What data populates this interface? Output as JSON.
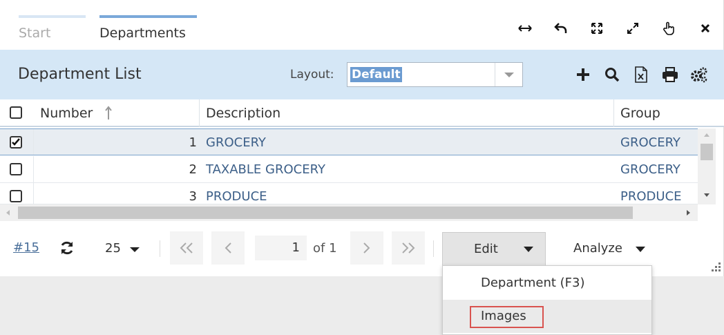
{
  "tabs": [
    {
      "label": "Start"
    },
    {
      "label": "Departments"
    }
  ],
  "window_icons": [
    "resize-horizontal-icon",
    "undo-icon",
    "fullscreen-icon",
    "expand-icon",
    "pointer-icon",
    "close-icon"
  ],
  "list": {
    "title": "Department List",
    "layout_label": "Layout:",
    "layout_value": "Default",
    "toolbar_icons": [
      "add-icon",
      "search-icon",
      "excel-icon",
      "print-icon",
      "settings-icon"
    ]
  },
  "columns": [
    {
      "label": "Number",
      "sort": "ascending"
    },
    {
      "label": "Description"
    },
    {
      "label": "Group"
    }
  ],
  "rows": [
    {
      "number": "1",
      "description": "GROCERY",
      "group": "GROCERY",
      "checked": true
    },
    {
      "number": "2",
      "description": "TAXABLE GROCERY",
      "group": "GROCERY",
      "checked": false
    },
    {
      "number": "3",
      "description": "PRODUCE",
      "group": "PRODUCE",
      "checked": false
    }
  ],
  "footer": {
    "record_count": "#15",
    "page_size": "25",
    "current_page": "1",
    "of_pages": "of 1",
    "edit_label": "Edit",
    "analyze_label": "Analyze"
  },
  "menu": {
    "items": [
      {
        "label": "Department (F3)"
      },
      {
        "label": "Images"
      }
    ]
  },
  "colors": {
    "header_bg": "#d5e7f6",
    "active_tab": "#7aa8d9",
    "link_text": "#3c5f88",
    "highlight_box": "#d9534f"
  }
}
